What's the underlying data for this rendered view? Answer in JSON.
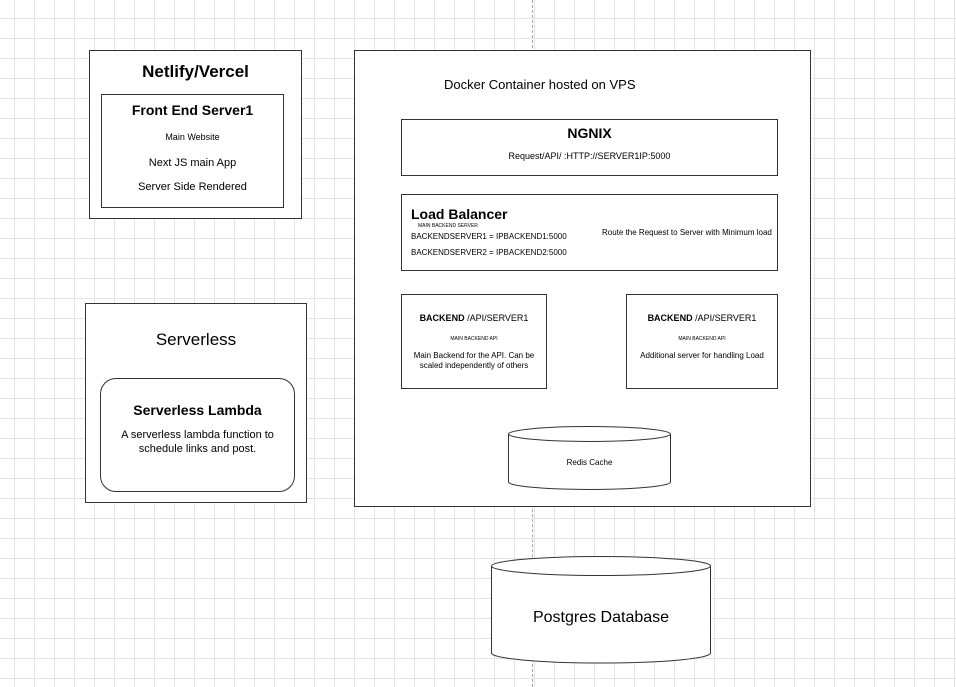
{
  "netlify": {
    "title": "Netlify/Vercel",
    "server_title": "Front End Server1",
    "line1": "Main Website",
    "line2": "Next JS main App",
    "line3": "Server Side Rendered"
  },
  "serverless": {
    "title": "Serverless",
    "lambda_title": "Serverless Lambda",
    "lambda_desc_1": "A serverless lambda function to",
    "lambda_desc_2": "schedule links and post."
  },
  "docker": {
    "title": "Docker Container hosted on VPS",
    "nginx": {
      "title": "NGNIX",
      "route": "Request/API/ :HTTP://SERVER1IP:5000"
    },
    "load_balancer": {
      "title": "Load Balancer",
      "sub": "MAIN BACKEND SERVER",
      "server1": "BACKENDSERVER1 = IPBACKEND1:5000",
      "server2": "BACKENDSERVER2 = IPBACKEND2:5000",
      "note": "Route the Request to Server with Minimum load"
    },
    "backend1": {
      "title_bold": "BACKEND",
      "title_rest": " /API/SERVER1",
      "sub": "MAIN BACKEND API",
      "desc_1": "Main Backend for the API. Can be",
      "desc_2": "scaled independently of others"
    },
    "backend2": {
      "title_bold": "BACKEND",
      "title_rest": " /API/SERVER1",
      "sub": "MAIN BACKEND API",
      "desc_1": "Additional server for handling Load"
    },
    "redis": {
      "label": "Redis Cache"
    }
  },
  "postgres": {
    "label": "Postgres Database"
  }
}
